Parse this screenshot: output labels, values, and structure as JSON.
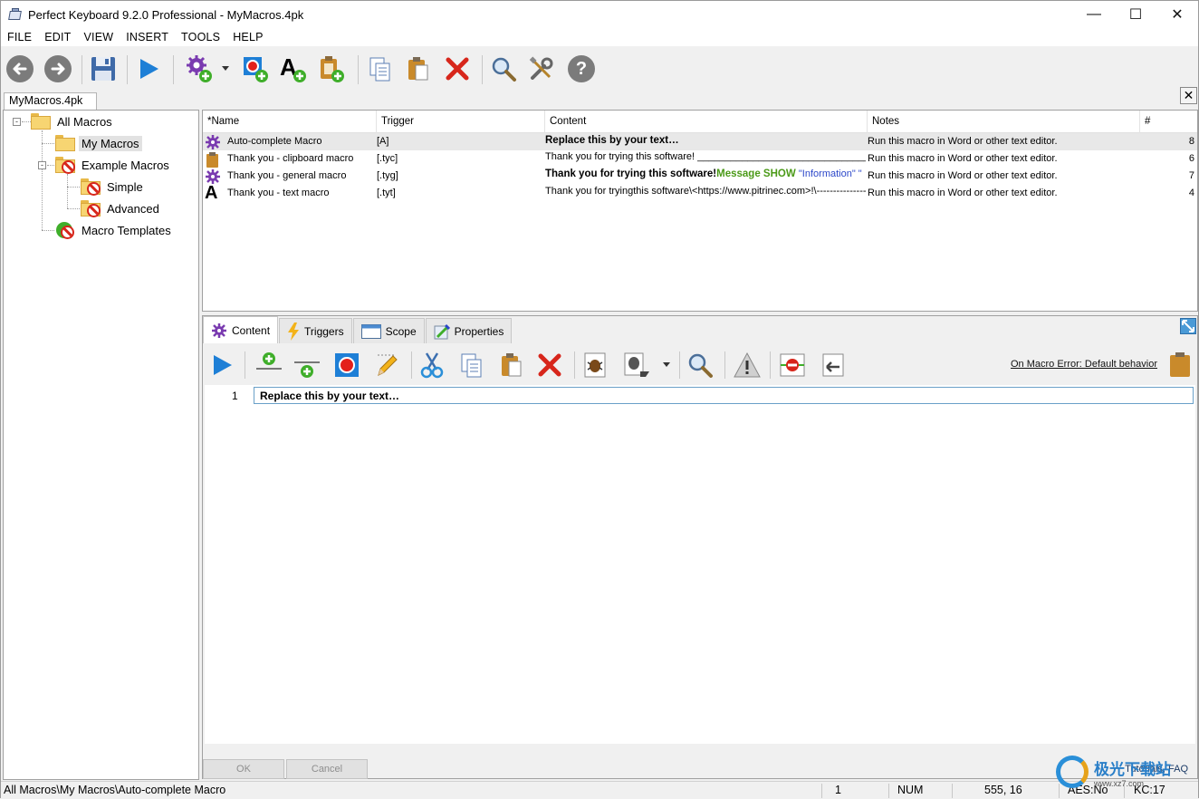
{
  "window": {
    "title": "Perfect Keyboard 9.2.0 Professional - MyMacros.4pk",
    "minimize": "—",
    "maximize": "☐",
    "close": "✕"
  },
  "menu": [
    "FILE",
    "EDIT",
    "VIEW",
    "INSERT",
    "TOOLS",
    "HELP"
  ],
  "toolbar_icons": [
    "back-icon",
    "forward-icon",
    "save-icon",
    "play-icon",
    "new-macro-icon",
    "dropdown-arrow-icon",
    "new-record-macro-icon",
    "new-text-macro-icon",
    "new-clipboard-macro-icon",
    "copy-icon",
    "paste-icon",
    "delete-icon",
    "search-icon",
    "tools-icon",
    "help-icon"
  ],
  "doc_tab": "MyMacros.4pk",
  "tree": {
    "root": "All Macros",
    "items": [
      "My Macros",
      "Example Macros",
      "Simple",
      "Advanced",
      "Macro Templates"
    ]
  },
  "list": {
    "columns": [
      "*Name",
      "Trigger",
      "Content",
      "Notes",
      "#"
    ],
    "rows": [
      {
        "name": "Auto-complete Macro",
        "trigger": "[A]",
        "content": "Replace this by your text…",
        "notes": "Run this macro in Word or other text editor.",
        "num": "8",
        "icon": "gear-icon"
      },
      {
        "name": "Thank you - clipboard macro",
        "trigger": "[.tyc]",
        "content": "Thank you for trying this software! ________________________________…",
        "notes": "Run this macro in Word or other text editor.",
        "num": "6",
        "icon": "clipboard-icon"
      },
      {
        "name": "Thank you - general macro",
        "trigger": "[.tyg]",
        "content_a": "Thank you for trying this software!",
        "content_b": "Message SHOW",
        "content_c": "\"Information\" \"",
        "notes": "Run this macro in Word or other text editor.",
        "num": "7",
        "icon": "gear-icon"
      },
      {
        "name": "Thank you - text macro",
        "trigger": "[.tyt]",
        "content": "Thank you for tryingthis software\\<https://www.pitrinec.com>!\\---------------…",
        "notes": "Run this macro in Word or other text editor.",
        "num": "4",
        "icon": "text-a-icon"
      }
    ]
  },
  "editor": {
    "tabs": [
      "Content",
      "Triggers",
      "Scope",
      "Properties"
    ],
    "on_error": "On Macro Error: Default behavior",
    "line_no": "1",
    "line_text": "Replace this by your text…",
    "ok": "OK",
    "cancel": "Cancel",
    "tutorials": "Tutorials, FAQ"
  },
  "status": {
    "path": "All Macros\\My Macros\\Auto-complete Macro",
    "count": "1",
    "num": "NUM",
    "pos": "555,  16",
    "aes": "AES:No",
    "kc": "KC:17"
  },
  "watermark": {
    "name": "极光下载站",
    "url": "www.xz7.com"
  },
  "colors": {
    "accent_blue": "#1e7fd6",
    "delete_red": "#d7261b",
    "message_green": "#4b9a18",
    "info_blue": "#2b47c9"
  }
}
